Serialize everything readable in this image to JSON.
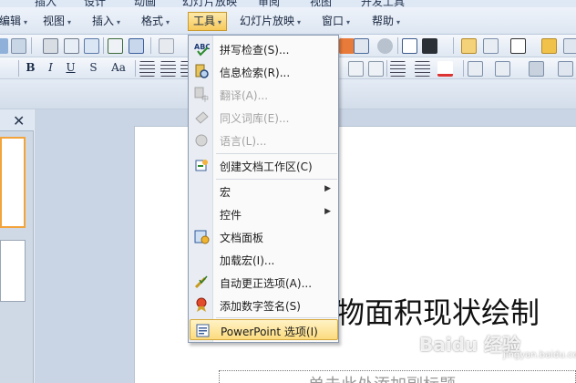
{
  "ribbon_tabs": [
    "插入",
    "设计",
    "动画",
    "幻灯片放映",
    "审阅",
    "视图",
    "开发工具"
  ],
  "menubar": {
    "items": [
      {
        "label": "编辑",
        "arrow": "▾"
      },
      {
        "label": "视图",
        "arrow": "▾"
      },
      {
        "label": "插入",
        "arrow": "▾"
      },
      {
        "label": "格式",
        "arrow": "▾"
      },
      {
        "label": "工具",
        "arrow": "▾"
      },
      {
        "label": "幻灯片放映",
        "arrow": "▾"
      },
      {
        "label": "窗口",
        "arrow": "▾"
      },
      {
        "label": "帮助",
        "arrow": "▾"
      }
    ]
  },
  "format_toolbar": {
    "bold": "B",
    "italic": "I",
    "underline": "U",
    "shadow": "S",
    "change_case": "Aa"
  },
  "left_panel": {
    "close_glyph": "✕"
  },
  "tools_menu": {
    "items": [
      {
        "label": "拼写检查(S)...",
        "icon": "spelling-icon",
        "disabled": false
      },
      {
        "label": "信息检索(R)...",
        "icon": "research-icon",
        "disabled": false
      },
      {
        "label": "翻译(A)...",
        "icon": "translate-icon",
        "disabled": true
      },
      {
        "label": "同义词库(E)...",
        "icon": "thesaurus-icon",
        "disabled": true
      },
      {
        "label": "语言(L)...",
        "icon": "language-icon",
        "disabled": true
      },
      {
        "label": "创建文档工作区(C)",
        "icon": "workspace-icon",
        "disabled": false
      },
      {
        "label": "宏",
        "submenu": true
      },
      {
        "label": "控件",
        "submenu": true
      },
      {
        "label": "文档面板",
        "icon": "document-panel-icon",
        "disabled": false
      },
      {
        "label": "加载宏(I)...",
        "disabled": false
      },
      {
        "label": "自动更正选项(A)...",
        "icon": "autocorrect-icon",
        "disabled": false
      },
      {
        "label": "添加数字签名(S)",
        "icon": "digital-signature-icon",
        "disabled": false
      },
      {
        "label": "PowerPoint 选项(I)",
        "icon": "options-icon",
        "disabled": false
      }
    ]
  },
  "slide": {
    "title": "物面积现状绘制",
    "subtitle": "单击此处添加副标题"
  },
  "watermark": {
    "text": "Baidu 经验",
    "sub": "jingyan.baidu.com"
  },
  "colors": {
    "menu_highlight": "#fcdb7e",
    "thumb_selected_border": "#f2a33a"
  }
}
